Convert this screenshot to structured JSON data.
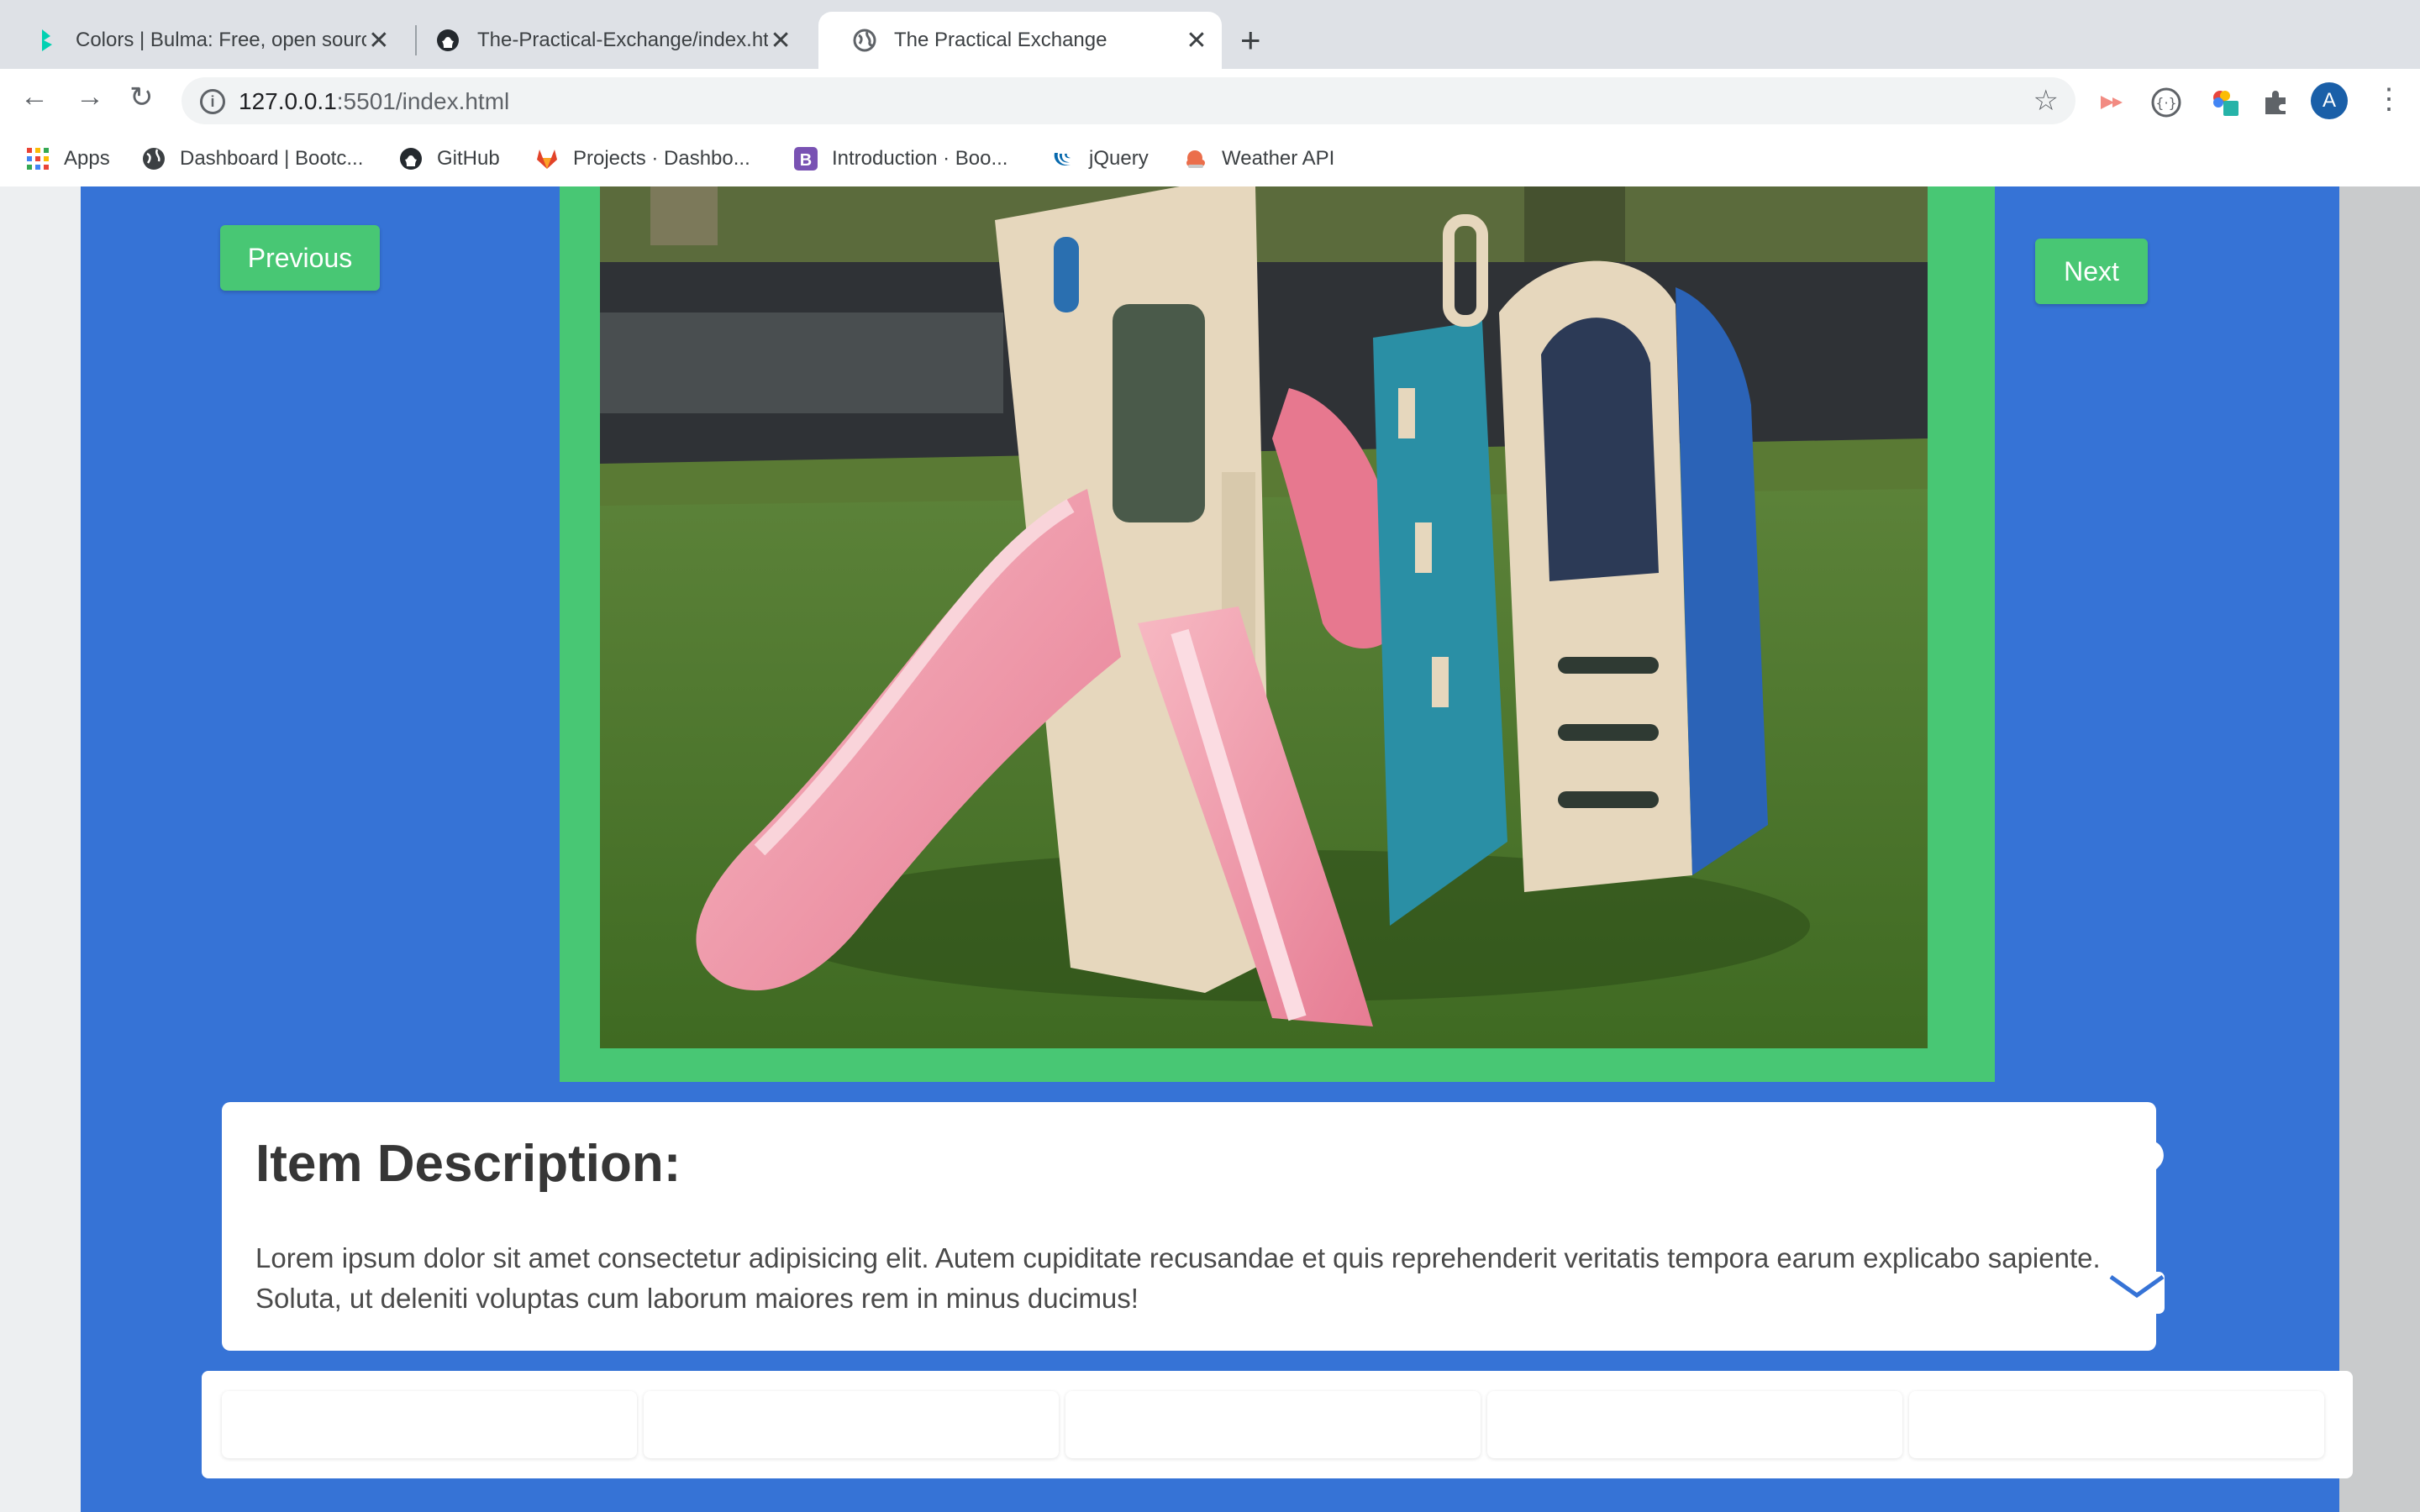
{
  "browser": {
    "tabs": [
      {
        "title": "Colors | Bulma: Free, open source",
        "icon": "bulma-icon"
      },
      {
        "title": "The-Practical-Exchange/index.html",
        "icon": "github-icon"
      },
      {
        "title": "The Practical Exchange",
        "icon": "globe-icon"
      }
    ],
    "close_glyph": "✕",
    "new_tab_glyph": "+",
    "url_host": "127.0.0.1",
    "url_rest": ":5501/index.html",
    "profile_initial": "A",
    "bookmarks": [
      {
        "label": "Apps",
        "icon": "apps-grid-icon"
      },
      {
        "label": "Dashboard | Bootc...",
        "icon": "globe-icon"
      },
      {
        "label": "GitHub",
        "icon": "github-icon"
      },
      {
        "label": "Projects · Dashbo...",
        "icon": "gitlab-icon"
      },
      {
        "label": "Introduction · Boo...",
        "icon": "bootstrap-icon"
      },
      {
        "label": "jQuery",
        "icon": "jquery-icon"
      },
      {
        "label": "Weather API",
        "icon": "weather-icon"
      }
    ]
  },
  "page": {
    "previous_label": "Previous",
    "next_label": "Next",
    "description_heading": "Item Description:",
    "description_text": "Lorem ipsum dolor sit amet consectetur adipisicing elit. Autem cupiditate recusandae et quis reprehenderit veritatis tempora earum explicabo sapiente. Soluta, ut deleniti voluptas cum laborum maiores rem in minus ducimus!",
    "actions": [
      {
        "icon": "heart-icon"
      },
      {
        "icon": "envelope-icon"
      }
    ],
    "colors": {
      "panel": "#3673d6",
      "accent_green": "#48c774"
    }
  }
}
